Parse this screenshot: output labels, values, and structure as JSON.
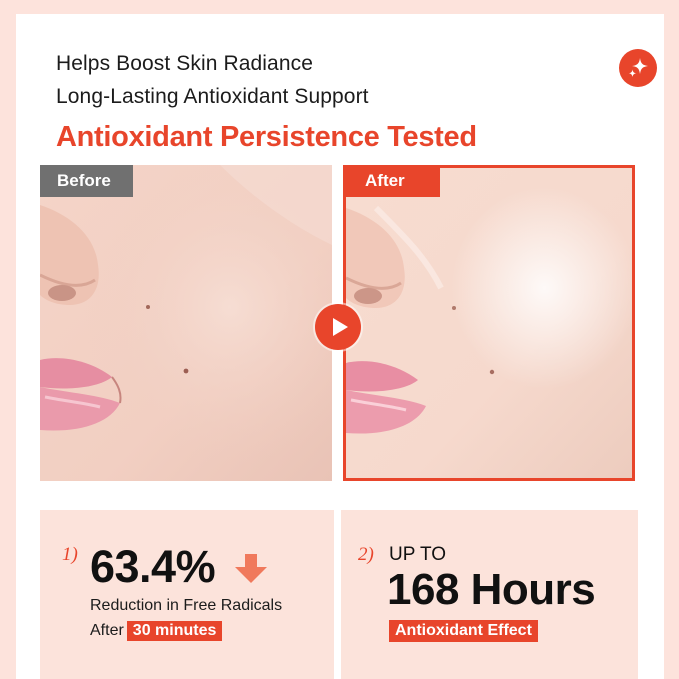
{
  "header": {
    "line1": "Helps Boost Skin Radiance",
    "line2": "Long-Lasting Antioxidant Support",
    "headline": "Antioxidant Persistence Tested",
    "badge_icon": "sparkle-icon"
  },
  "comparison": {
    "before_label": "Before",
    "after_label": "After",
    "play_icon": "play-icon"
  },
  "stats": [
    {
      "number": "1)",
      "value": "63.4%",
      "arrow_icon": "down-arrow-icon",
      "description": "Reduction in Free Radicals",
      "after_prefix": "After",
      "after_highlight": "30 minutes"
    },
    {
      "number": "2)",
      "prefix": "UP TO",
      "value": "168 Hours",
      "highlight": "Antioxidant Effect"
    }
  ],
  "colors": {
    "accent": "#e8452b",
    "background": "#fde3dc",
    "panel": "#fce3db",
    "before_tag": "#707070"
  }
}
